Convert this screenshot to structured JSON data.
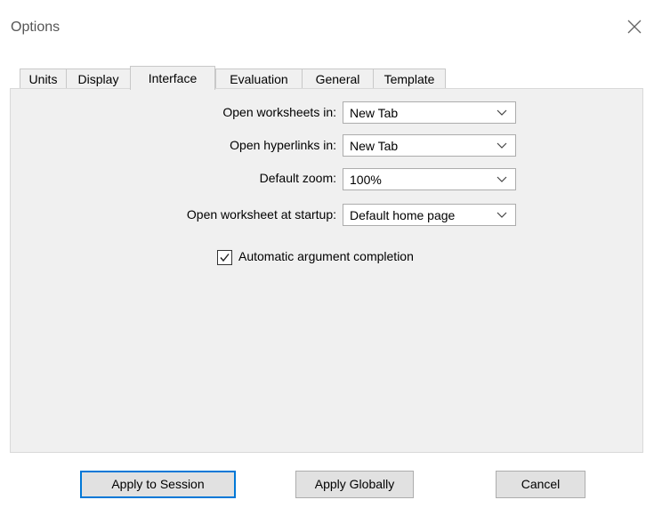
{
  "window": {
    "title": "Options"
  },
  "tabs": [
    {
      "label": "Units"
    },
    {
      "label": "Display"
    },
    {
      "label": "Interface",
      "active": true
    },
    {
      "label": "Evaluation"
    },
    {
      "label": "General"
    },
    {
      "label": "Template"
    }
  ],
  "interface": {
    "open_worksheets": {
      "label": "Open worksheets in:",
      "value": "New Tab"
    },
    "open_hyperlinks": {
      "label": "Open hyperlinks in:",
      "value": "New Tab"
    },
    "default_zoom": {
      "label": "Default zoom:",
      "value": "100%"
    },
    "open_at_startup": {
      "label": "Open worksheet at startup:",
      "value": "Default home page"
    },
    "auto_completion": {
      "label": "Automatic argument completion",
      "checked": true
    }
  },
  "buttons": {
    "apply_session": "Apply to Session",
    "apply_globally": "Apply Globally",
    "cancel": "Cancel"
  }
}
